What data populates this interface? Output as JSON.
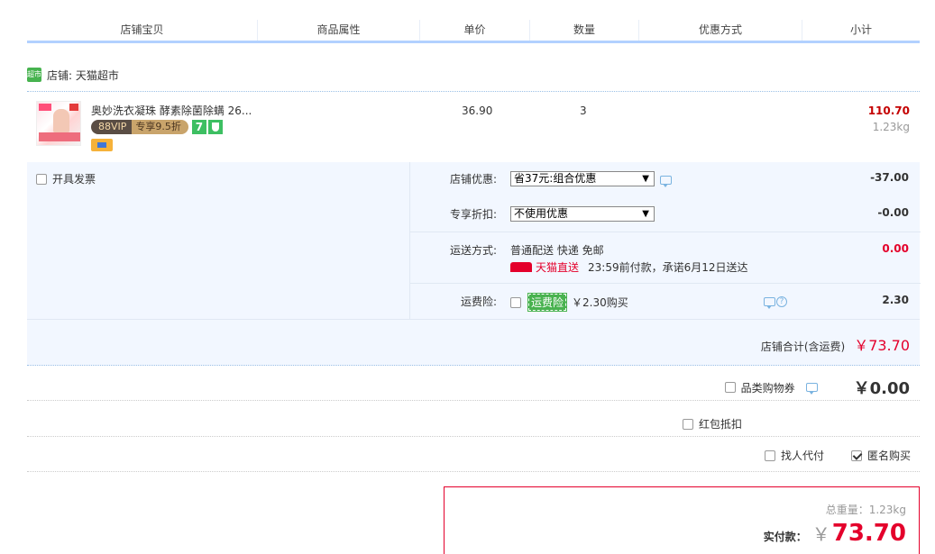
{
  "header": {
    "columns": [
      "店铺宝贝",
      "商品属性",
      "单价",
      "数量",
      "优惠方式",
      "小计"
    ]
  },
  "shop": {
    "icon_text": "超市",
    "label": "店铺: 天猫超市"
  },
  "item": {
    "title": "奥妙洗衣凝珠 酵素除菌除螨 26...",
    "vip_left": "88VIP",
    "vip_right": "专享9.5折",
    "badge_seven": "7",
    "unit_price": "36.90",
    "quantity": "3",
    "subtotal": "110.70",
    "weight": "1.23kg"
  },
  "options": {
    "invoice_label": "开具发票",
    "shop_discount_label": "店铺优惠:",
    "shop_discount_selected": "省37元:组合优惠",
    "shop_discount_value": "-37.00",
    "exclusive_discount_label": "专享折扣:",
    "exclusive_discount_selected": "不使用优惠",
    "exclusive_discount_value": "-0.00",
    "shipping_label": "运送方式:",
    "shipping_method": "普通配送 快递 免邮",
    "tmall_direct": "天猫直送",
    "delivery_promise": "23:59前付款，承诺6月12日送达",
    "shipping_value": "0.00",
    "insurance_label": "运费险:",
    "insurance_badge": "运费险",
    "insurance_price": "￥2.30购买",
    "insurance_value": "2.30",
    "shop_total_label": "店铺合计(含运费)",
    "shop_total_value": "￥73.70"
  },
  "extras": {
    "category_coupon_label": "品类购物券",
    "category_coupon_value": "￥0.00",
    "red_packet_label": "红包抵扣",
    "proxy_pay_label": "找人代付",
    "anonymous_label": "匿名购买"
  },
  "payment": {
    "total_weight": "总重量：1.23kg",
    "actual_label": "实付款：",
    "currency": "￥",
    "actual_amount": "73.70"
  },
  "colors": {
    "accent_red": "#e4002b",
    "header_border": "#b2d1ff",
    "panel_bg": "#f2f7ff"
  }
}
